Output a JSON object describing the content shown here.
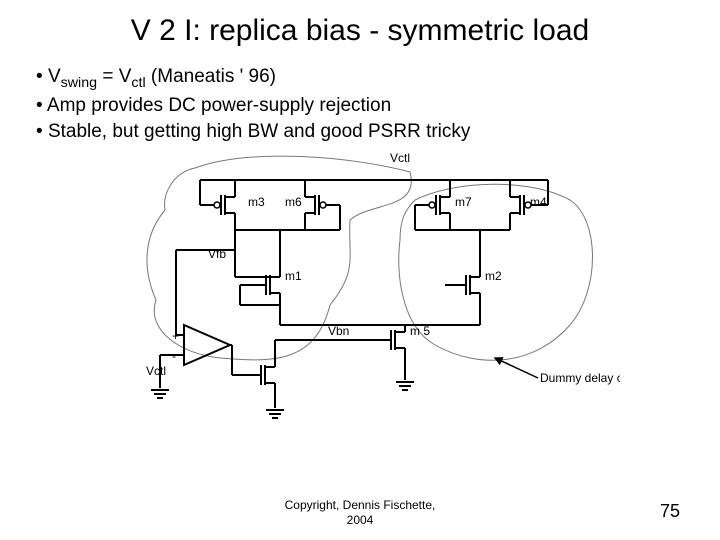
{
  "title": "V 2 I: replica bias - symmetric load",
  "bullets": [
    {
      "pre": "V",
      "sub1": "swing",
      "mid": " = V",
      "sub2": "ctl",
      "post": "  (Maneatis ' 96)"
    },
    {
      "text": "Amp provides DC power-supply rejection"
    },
    {
      "text": "Stable, but getting high BW and good PSRR tricky"
    }
  ],
  "labels": {
    "vctl_top": "Vctl",
    "m3": "m3",
    "m6": "m6",
    "m7": "m7",
    "m4": "m4",
    "vfb": "Vfb",
    "m1": "m1",
    "m2": "m2",
    "plus": "+",
    "minus": "-",
    "vctl_amp": "Vctl",
    "vbn": "Vbn",
    "m5": "m 5",
    "dummy": "Dummy delay cell"
  },
  "footer": {
    "copyright": "Copyright, Dennis Fischette,",
    "year": "2004"
  },
  "page": "75"
}
